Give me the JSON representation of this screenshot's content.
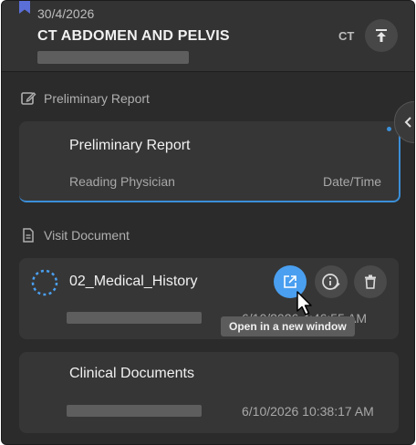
{
  "header": {
    "date": "30/4/2026",
    "title": "CT ABDOMEN AND PELVIS",
    "modality": "CT",
    "bookmark_color": "#5b6fd8"
  },
  "preliminary": {
    "section_label": "Preliminary Report",
    "card_title": "Preliminary Report",
    "reading_physician": "Reading Physician",
    "date_time": "Date/Time"
  },
  "visit": {
    "section_label": "Visit Document",
    "doc1": {
      "title": "02_Medical_History",
      "time": "6/10/2026 4:46:55 AM"
    },
    "tooltip": "Open in a new window",
    "doc2": {
      "title": "Clinical Documents",
      "time": "6/10/2026 10:38:17 AM"
    }
  },
  "colors": {
    "accent": "#3b8fd8",
    "open_button": "#4a9ff0"
  },
  "icons": [
    "bookmark-icon",
    "upload-icon",
    "edit-note-icon",
    "chevron-left-icon",
    "document-icon",
    "loading-spinner-icon",
    "open-external-icon",
    "info-edit-icon",
    "trash-icon",
    "mouse-cursor-icon"
  ]
}
